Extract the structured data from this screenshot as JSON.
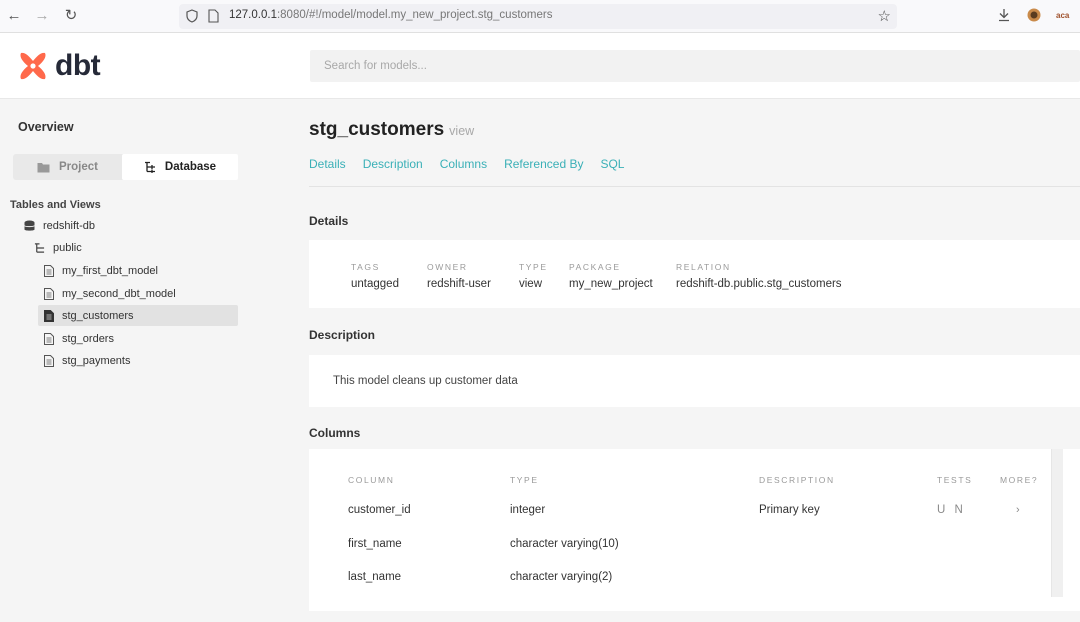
{
  "browser": {
    "url_host": "127.0.0.1",
    "url_rest": ":8080/#!/model/model.my_new_project.stg_customers",
    "profile_label": "aca"
  },
  "header": {
    "logo_text": "dbt",
    "search_placeholder": "Search for models...",
    "brand_color": "#ff694b"
  },
  "sidebar": {
    "overview_label": "Overview",
    "toggle": {
      "project_label": "Project",
      "database_label": "Database",
      "selected": "Database"
    },
    "tables_title": "Tables and Views",
    "tree": {
      "db": "redshift-db",
      "schema": "public",
      "models": [
        "my_first_dbt_model",
        "my_second_dbt_model",
        "stg_customers",
        "stg_orders",
        "stg_payments"
      ],
      "selected_model": "stg_customers"
    }
  },
  "main": {
    "title": "stg_customers",
    "kind": "view",
    "tabs": [
      "Details",
      "Description",
      "Columns",
      "Referenced By",
      "SQL"
    ],
    "accent_color": "#3ab0b7",
    "details": {
      "heading": "Details",
      "fields": [
        {
          "label": "TAGS",
          "value": "untagged"
        },
        {
          "label": "OWNER",
          "value": "redshift-user"
        },
        {
          "label": "TYPE",
          "value": "view"
        },
        {
          "label": "PACKAGE",
          "value": "my_new_project"
        },
        {
          "label": "RELATION",
          "value": "redshift-db.public.stg_customers"
        }
      ]
    },
    "description": {
      "heading": "Description",
      "text": "This model cleans up customer data"
    },
    "columns": {
      "heading": "Columns",
      "headers": [
        "COLUMN",
        "TYPE",
        "DESCRIPTION",
        "TESTS",
        "MORE?"
      ],
      "rows": [
        {
          "column": "customer_id",
          "type": "integer",
          "description": "Primary key",
          "tests": "U N",
          "more": "›"
        },
        {
          "column": "first_name",
          "type": "character varying(10)",
          "description": "",
          "tests": "",
          "more": ""
        },
        {
          "column": "last_name",
          "type": "character varying(2)",
          "description": "",
          "tests": "",
          "more": ""
        }
      ]
    }
  }
}
